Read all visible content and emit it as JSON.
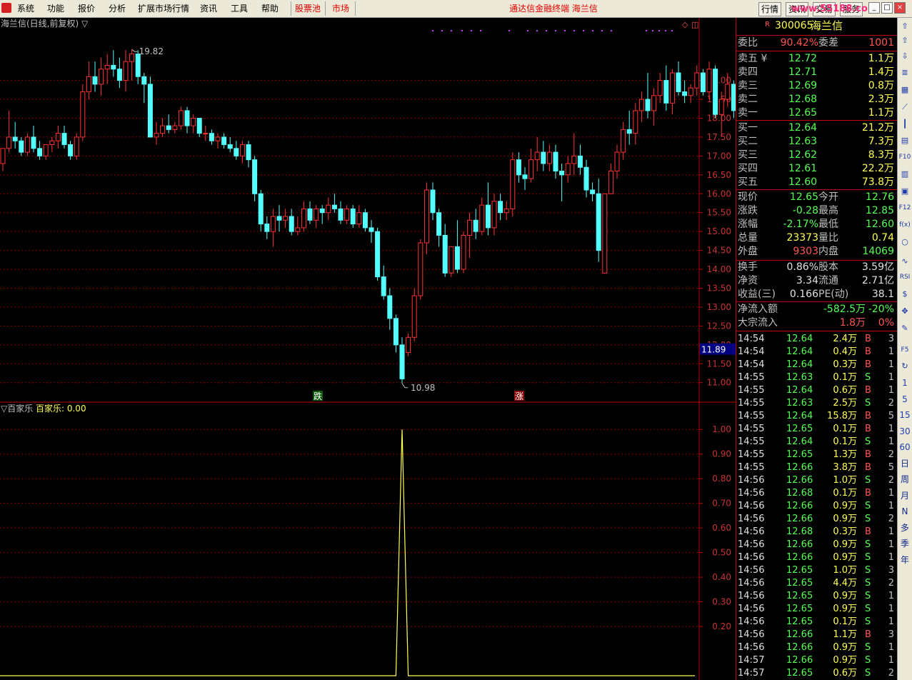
{
  "menu": {
    "items": [
      "系统",
      "功能",
      "报价",
      "分析",
      "扩展市场行情",
      "资讯",
      "工具",
      "帮助"
    ],
    "stock_pool": "股票池",
    "market": "市场",
    "title": "通达信金融终端  海兰信",
    "right_buttons": [
      "行情",
      "资讯",
      "交易",
      "服务"
    ],
    "watermark": "www.55188.com"
  },
  "chart": {
    "title": "海兰信(日线,前复权) ▽",
    "high_label": "19.82",
    "low_label": "10.98",
    "current_price_tag": "11.89",
    "marker_die": "跌",
    "marker_zhang": "涨",
    "price_axis": [
      "19.00",
      "18.50",
      "18.00",
      "17.50",
      "17.00",
      "16.50",
      "16.00",
      "15.50",
      "15.00",
      "14.50",
      "14.00",
      "13.50",
      "13.00",
      "12.50",
      "12.00",
      "11.50",
      "11.00"
    ],
    "indicator_title": "▽百家乐",
    "indicator_series": "百家乐: 0.00",
    "indicator_axis": [
      "1.00",
      "0.90",
      "0.80",
      "0.70",
      "0.60",
      "0.50",
      "0.40",
      "0.30",
      "0.20"
    ],
    "colors": {
      "up": "#ff3232",
      "down": "#54ffff",
      "grid": "#8b0000",
      "axis_text": "#c83232",
      "indicator": "#ffff54"
    }
  },
  "chart_data": {
    "type": "candlestick",
    "y_range": [
      10.9,
      19.9
    ],
    "candles": [
      [
        16.8,
        17.2,
        16.6,
        17.2
      ],
      [
        17.2,
        18.2,
        17.1,
        17.5
      ],
      [
        17.5,
        17.9,
        17.2,
        17.4
      ],
      [
        17.4,
        17.5,
        17.0,
        17.1
      ],
      [
        17.1,
        17.6,
        17.0,
        17.5
      ],
      [
        17.5,
        17.8,
        17.1,
        17.2
      ],
      [
        17.2,
        17.4,
        16.9,
        17.0
      ],
      [
        17.0,
        17.3,
        16.9,
        17.3
      ],
      [
        17.3,
        17.5,
        17.1,
        17.4
      ],
      [
        17.4,
        17.8,
        17.2,
        17.6
      ],
      [
        17.6,
        17.8,
        17.2,
        17.3
      ],
      [
        17.3,
        17.4,
        16.9,
        17.0
      ],
      [
        17.0,
        17.6,
        16.9,
        17.5
      ],
      [
        17.5,
        18.9,
        17.4,
        18.7
      ],
      [
        18.7,
        19.5,
        18.5,
        19.1
      ],
      [
        19.1,
        19.5,
        18.7,
        18.9
      ],
      [
        18.9,
        19.6,
        18.6,
        19.3
      ],
      [
        19.3,
        19.7,
        18.9,
        19.4
      ],
      [
        19.4,
        19.8,
        19.1,
        19.3
      ],
      [
        19.3,
        19.6,
        18.8,
        19.0
      ],
      [
        19.0,
        19.8,
        18.7,
        19.5
      ],
      [
        19.5,
        19.82,
        19.0,
        19.7
      ],
      [
        19.7,
        19.8,
        18.9,
        19.1
      ],
      [
        19.1,
        19.2,
        18.4,
        18.9
      ],
      [
        18.9,
        19.1,
        17.5,
        17.5
      ],
      [
        17.5,
        17.9,
        17.3,
        17.6
      ],
      [
        17.6,
        18.0,
        17.5,
        17.8
      ],
      [
        17.8,
        18.1,
        17.6,
        17.7
      ],
      [
        17.7,
        17.9,
        17.6,
        17.8
      ],
      [
        17.8,
        18.3,
        17.7,
        18.2
      ],
      [
        18.2,
        18.3,
        17.6,
        17.8
      ],
      [
        17.8,
        18.1,
        17.6,
        18.0
      ],
      [
        18.0,
        18.0,
        17.5,
        17.6
      ],
      [
        17.6,
        17.8,
        17.4,
        17.6
      ],
      [
        17.6,
        17.7,
        17.3,
        17.4
      ],
      [
        17.4,
        17.6,
        17.2,
        17.5
      ],
      [
        17.5,
        17.6,
        17.2,
        17.3
      ],
      [
        17.3,
        17.5,
        17.1,
        17.2
      ],
      [
        17.2,
        17.4,
        16.9,
        17.0
      ],
      [
        17.0,
        17.4,
        16.8,
        17.3
      ],
      [
        17.3,
        17.4,
        16.7,
        16.9
      ],
      [
        16.9,
        17.0,
        15.8,
        16.0
      ],
      [
        16.0,
        16.1,
        15.0,
        15.2
      ],
      [
        15.2,
        15.4,
        14.8,
        15.0
      ],
      [
        15.0,
        15.6,
        14.6,
        15.4
      ],
      [
        15.4,
        15.7,
        15.0,
        15.3
      ],
      [
        15.3,
        15.6,
        15.1,
        15.4
      ],
      [
        15.4,
        15.6,
        14.9,
        15.0
      ],
      [
        15.0,
        15.4,
        14.9,
        15.1
      ],
      [
        15.1,
        15.8,
        15.0,
        15.6
      ],
      [
        15.6,
        15.8,
        15.2,
        15.3
      ],
      [
        15.3,
        15.7,
        15.1,
        15.6
      ],
      [
        15.6,
        15.7,
        15.2,
        15.5
      ],
      [
        15.5,
        15.9,
        15.3,
        15.7
      ],
      [
        15.7,
        16.0,
        15.5,
        15.6
      ],
      [
        15.6,
        15.8,
        15.2,
        15.3
      ],
      [
        15.3,
        15.7,
        15.2,
        15.6
      ],
      [
        15.6,
        15.7,
        15.1,
        15.2
      ],
      [
        15.2,
        15.7,
        15.1,
        15.5
      ],
      [
        15.5,
        15.6,
        15.0,
        15.1
      ],
      [
        15.1,
        15.3,
        14.7,
        15.0
      ],
      [
        15.0,
        15.1,
        13.7,
        13.8
      ],
      [
        13.8,
        14.1,
        13.2,
        13.3
      ],
      [
        13.3,
        13.5,
        12.4,
        12.7
      ],
      [
        12.7,
        12.8,
        11.8,
        12.0
      ],
      [
        12.0,
        12.2,
        10.98,
        11.1
      ],
      [
        11.8,
        12.3,
        11.7,
        12.2
      ],
      [
        12.2,
        13.5,
        12.1,
        13.3
      ],
      [
        13.3,
        14.8,
        13.2,
        14.7
      ],
      [
        14.7,
        16.3,
        14.4,
        16.1
      ],
      [
        16.1,
        16.3,
        15.3,
        15.5
      ],
      [
        15.5,
        15.6,
        14.6,
        14.9
      ],
      [
        14.9,
        15.2,
        13.8,
        13.9
      ],
      [
        13.9,
        14.6,
        13.8,
        14.6
      ],
      [
        14.6,
        15.3,
        13.9,
        14.0
      ],
      [
        14.0,
        15.0,
        13.9,
        14.9
      ],
      [
        14.9,
        15.5,
        14.3,
        15.3
      ],
      [
        15.3,
        15.6,
        14.8,
        15.0
      ],
      [
        15.0,
        15.9,
        14.9,
        15.7
      ],
      [
        15.7,
        16.3,
        14.9,
        15.1
      ],
      [
        15.1,
        16.0,
        14.9,
        15.8
      ],
      [
        15.8,
        16.0,
        15.3,
        15.5
      ],
      [
        15.5,
        15.8,
        15.3,
        15.6
      ],
      [
        15.6,
        17.1,
        15.4,
        16.9
      ],
      [
        16.9,
        17.1,
        16.3,
        16.5
      ],
      [
        16.5,
        16.7,
        16.1,
        16.4
      ],
      [
        16.4,
        17.2,
        16.3,
        16.9
      ],
      [
        16.9,
        17.5,
        16.6,
        17.1
      ],
      [
        17.1,
        17.4,
        16.6,
        16.8
      ],
      [
        16.8,
        17.3,
        16.6,
        17.1
      ],
      [
        17.1,
        17.3,
        16.4,
        16.6
      ],
      [
        16.6,
        16.8,
        15.8,
        16.5
      ],
      [
        16.5,
        17.0,
        16.3,
        16.8
      ],
      [
        16.8,
        17.6,
        16.5,
        17.0
      ],
      [
        17.0,
        17.3,
        16.5,
        16.7
      ],
      [
        16.7,
        16.9,
        15.9,
        16.1
      ],
      [
        16.1,
        16.3,
        15.8,
        16.0
      ],
      [
        16.0,
        16.4,
        14.2,
        14.5
      ],
      [
        13.9,
        16.0,
        13.9,
        16.0
      ],
      [
        16.0,
        16.8,
        16.0,
        16.6
      ],
      [
        16.6,
        17.3,
        16.4,
        17.1
      ],
      [
        17.1,
        17.9,
        16.9,
        17.7
      ],
      [
        17.7,
        18.2,
        17.3,
        17.6
      ],
      [
        17.6,
        18.4,
        17.3,
        18.2
      ],
      [
        18.2,
        18.7,
        17.9,
        18.5
      ],
      [
        18.5,
        19.2,
        18.0,
        18.2
      ],
      [
        18.2,
        18.8,
        17.8,
        18.6
      ],
      [
        18.6,
        19.2,
        18.4,
        19.0
      ],
      [
        19.0,
        19.4,
        18.2,
        18.4
      ],
      [
        18.4,
        19.3,
        18.1,
        19.2
      ],
      [
        19.2,
        19.5,
        18.6,
        18.7
      ],
      [
        18.7,
        19.0,
        18.4,
        18.6
      ],
      [
        18.6,
        18.9,
        18.4,
        18.8
      ],
      [
        18.8,
        19.4,
        18.6,
        19.2
      ],
      [
        19.2,
        19.3,
        18.6,
        18.7
      ],
      [
        18.7,
        19.5,
        18.5,
        19.3
      ],
      [
        19.3,
        19.4,
        18.0,
        18.1
      ],
      [
        18.1,
        18.7,
        17.5,
        18.5
      ],
      [
        18.5,
        19.2,
        18.3,
        18.9
      ],
      [
        18.9,
        19.0,
        18.0,
        18.2
      ],
      [
        18.2,
        18.7,
        17.6,
        17.8
      ],
      [
        17.8,
        18.3,
        17.5,
        17.6
      ],
      [
        17.6,
        18.2,
        17.4,
        17.9
      ],
      [
        17.9,
        18.2,
        17.7,
        18.0
      ],
      [
        18.0,
        18.0,
        16.8,
        16.9
      ],
      [
        16.9,
        17.3,
        16.7,
        17.0
      ],
      [
        17.0,
        17.1,
        15.9,
        16.2
      ],
      [
        16.2,
        17.0,
        16.1,
        16.9
      ],
      [
        16.9,
        17.0,
        16.5,
        16.7
      ],
      [
        16.7,
        17.0,
        16.4,
        16.9
      ],
      [
        16.9,
        17.1,
        16.6,
        16.8
      ],
      [
        16.8,
        17.1,
        16.2,
        16.9
      ],
      [
        16.9,
        17.0,
        16.4,
        16.5
      ]
    ],
    "indicator": {
      "name": "百家乐",
      "range": [
        0,
        1.05
      ],
      "spike_index": 65
    }
  },
  "quote": {
    "code": "300065",
    "name": "海兰信",
    "r_badge": "R",
    "weibi_label": "委比",
    "weibi": "90.42%",
    "weicha_label": "委差",
    "weicha": "1001",
    "sells": [
      {
        "label": "卖五 ¥",
        "price": "12.72",
        "vol": "1.1万"
      },
      {
        "label": "卖四",
        "price": "12.71",
        "vol": "1.4万"
      },
      {
        "label": "卖三",
        "price": "12.69",
        "vol": "0.8万"
      },
      {
        "label": "卖二",
        "price": "12.68",
        "vol": "2.3万"
      },
      {
        "label": "卖一",
        "price": "12.65",
        "vol": "1.1万"
      }
    ],
    "buys": [
      {
        "label": "买一",
        "price": "12.64",
        "vol": "21.2万"
      },
      {
        "label": "买二",
        "price": "12.63",
        "vol": "7.3万"
      },
      {
        "label": "买三",
        "price": "12.62",
        "vol": "8.3万"
      },
      {
        "label": "买四",
        "price": "12.61",
        "vol": "22.2万"
      },
      {
        "label": "买五",
        "price": "12.60",
        "vol": "73.8万"
      }
    ],
    "stats": [
      {
        "l1": "现价",
        "v1": "12.65",
        "c1": "#54ff54",
        "l2": "今开",
        "v2": "12.76",
        "c2": "#54ff54"
      },
      {
        "l1": "涨跌",
        "v1": "-0.28",
        "c1": "#54ff54",
        "l2": "最高",
        "v2": "12.85",
        "c2": "#54ff54"
      },
      {
        "l1": "涨幅",
        "v1": "-2.17%",
        "c1": "#54ff54",
        "l2": "最低",
        "v2": "12.60",
        "c2": "#54ff54"
      },
      {
        "l1": "总量",
        "v1": "23373",
        "c1": "#ffff54",
        "l2": "量比",
        "v2": "0.74",
        "c2": "#ffff54"
      },
      {
        "l1": "外盘",
        "v1": "9303",
        "c1": "#ff5454",
        "l2": "内盘",
        "v2": "14069",
        "c2": "#54ff54"
      }
    ],
    "stats2": [
      {
        "l1": "换手",
        "v1": "0.86%",
        "l2": "股本",
        "v2": "3.59亿"
      },
      {
        "l1": "净资",
        "v1": "3.34",
        "l2": "流通",
        "v2": "2.71亿"
      },
      {
        "l1": "收益(三)",
        "v1": "0.166",
        "l2": "PE(动)",
        "v2": "38.1"
      }
    ],
    "flow": [
      {
        "label": "净流入额",
        "value": "-582.5万",
        "pct": "-20%",
        "color": "#54ff54"
      },
      {
        "label": "大宗流入",
        "value": "1.8万",
        "pct": "0%",
        "color": "#ff5454"
      }
    ],
    "ticks": [
      [
        "14:54",
        "12.64",
        "2.4万",
        "B",
        "3"
      ],
      [
        "14:54",
        "12.64",
        "0.4万",
        "B",
        "1"
      ],
      [
        "14:54",
        "12.64",
        "0.3万",
        "B",
        "1"
      ],
      [
        "14:55",
        "12.63",
        "0.1万",
        "S",
        "1"
      ],
      [
        "14:55",
        "12.64",
        "0.6万",
        "B",
        "1"
      ],
      [
        "14:55",
        "12.63",
        "2.5万",
        "S",
        "2"
      ],
      [
        "14:55",
        "12.64",
        "15.8万",
        "B",
        "5"
      ],
      [
        "14:55",
        "12.65",
        "0.1万",
        "B",
        "1"
      ],
      [
        "14:55",
        "12.64",
        "0.1万",
        "S",
        "1"
      ],
      [
        "14:55",
        "12.65",
        "1.3万",
        "B",
        "2"
      ],
      [
        "14:55",
        "12.66",
        "3.8万",
        "B",
        "5"
      ],
      [
        "14:56",
        "12.66",
        "1.0万",
        "S",
        "2"
      ],
      [
        "14:56",
        "12.68",
        "0.1万",
        "B",
        "1"
      ],
      [
        "14:56",
        "12.66",
        "0.9万",
        "S",
        "1"
      ],
      [
        "14:56",
        "12.66",
        "0.9万",
        "S",
        "2"
      ],
      [
        "14:56",
        "12.68",
        "0.3万",
        "B",
        "1"
      ],
      [
        "14:56",
        "12.66",
        "0.9万",
        "S",
        "1"
      ],
      [
        "14:56",
        "12.66",
        "0.9万",
        "S",
        "1"
      ],
      [
        "14:56",
        "12.65",
        "1.0万",
        "S",
        "3"
      ],
      [
        "14:56",
        "12.65",
        "4.4万",
        "S",
        "2"
      ],
      [
        "14:56",
        "12.65",
        "0.9万",
        "S",
        "1"
      ],
      [
        "14:56",
        "12.65",
        "0.9万",
        "S",
        "1"
      ],
      [
        "14:56",
        "12.65",
        "0.1万",
        "S",
        "1"
      ],
      [
        "14:56",
        "12.66",
        "1.1万",
        "B",
        "3"
      ],
      [
        "14:56",
        "12.66",
        "0.9万",
        "S",
        "1"
      ],
      [
        "14:57",
        "12.66",
        "0.9万",
        "S",
        "1"
      ],
      [
        "14:57",
        "12.65",
        "0.6万",
        "S",
        "2"
      ]
    ]
  },
  "toolbar": {
    "period_labels": [
      "1",
      "5",
      "15",
      "30",
      "60",
      "日",
      "周",
      "月",
      "N",
      "多",
      "季",
      "年"
    ],
    "icon_names": [
      "up-arrow-icon",
      "up-arrow-2-icon",
      "down-arrow-icon",
      "list-icon",
      "table-icon",
      "line-chart-icon",
      "kline-icon",
      "doc-icon",
      "f10-icon",
      "panel-icon",
      "calendar-icon",
      "f12-icon",
      "fx-icon",
      "circle-icon",
      "wave-icon",
      "rsi-icon",
      "dollar-icon",
      "move-icon",
      "pen-icon",
      "f5-icon",
      "refresh-icon"
    ],
    "rsi": "RSI",
    "f10": "F10",
    "f12": "F12",
    "f5": "F5",
    "fx": "f(x)"
  }
}
